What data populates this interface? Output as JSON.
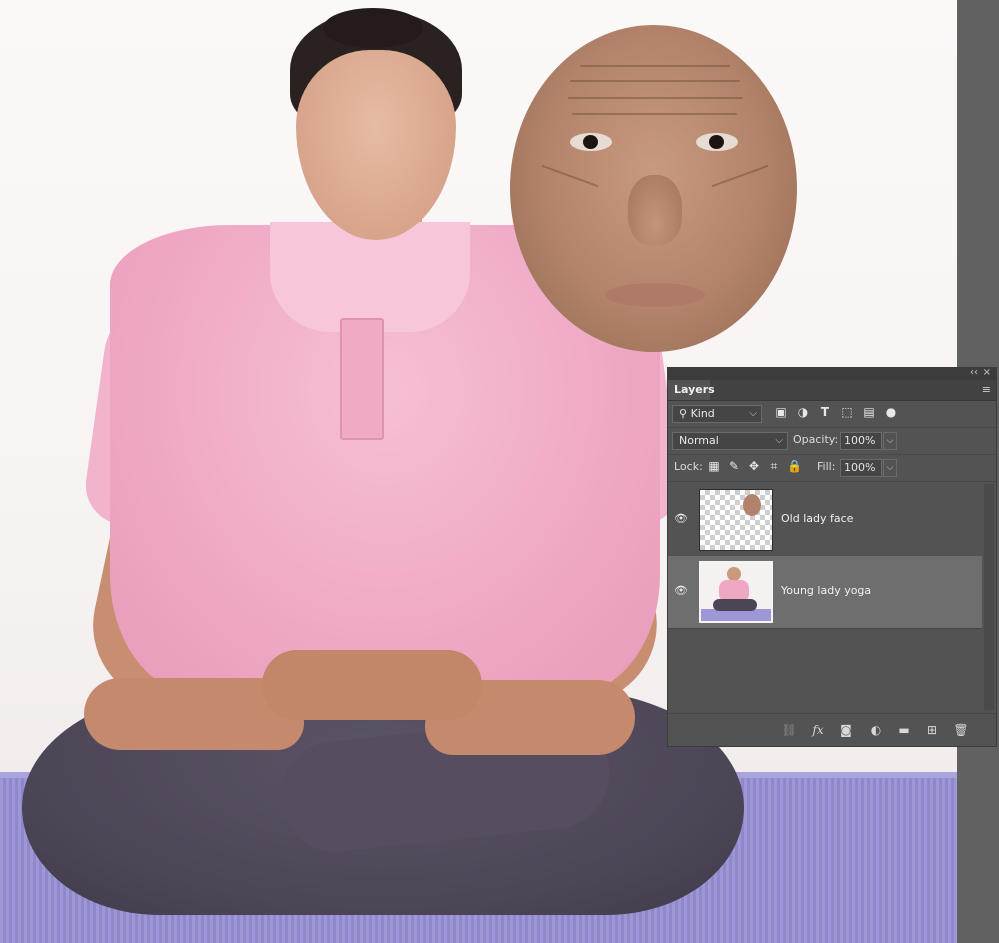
{
  "panel": {
    "tab_label": "Layers",
    "collapse_glyph": "‹‹",
    "close_glyph": "×",
    "menu_glyph": "≡",
    "filter": {
      "kind_label": "Kind",
      "icons": [
        "image-filter-icon",
        "adjustment-filter-icon",
        "type-filter-icon",
        "shape-filter-icon",
        "smart-object-filter-icon",
        "filter-toggle-icon"
      ]
    },
    "blend_mode": "Normal",
    "opacity_label": "Opacity:",
    "opacity_value": "100%",
    "lock_label": "Lock:",
    "fill_label": "Fill:",
    "fill_value": "100%",
    "layers": [
      {
        "name": "Old lady face",
        "selected": false,
        "visible": true
      },
      {
        "name": "Young lady yoga",
        "selected": true,
        "visible": true
      }
    ],
    "footer_icons": [
      "link-layers-icon",
      "fx-icon",
      "layer-mask-icon",
      "adjustment-layer-icon",
      "new-group-icon",
      "new-layer-icon",
      "delete-layer-icon"
    ]
  },
  "colors": {
    "panel_bg": "#535353",
    "selected_layer": "#6e6e6e",
    "shirt_pink": "#efa8c4",
    "mat_purple": "#9d97d6"
  }
}
